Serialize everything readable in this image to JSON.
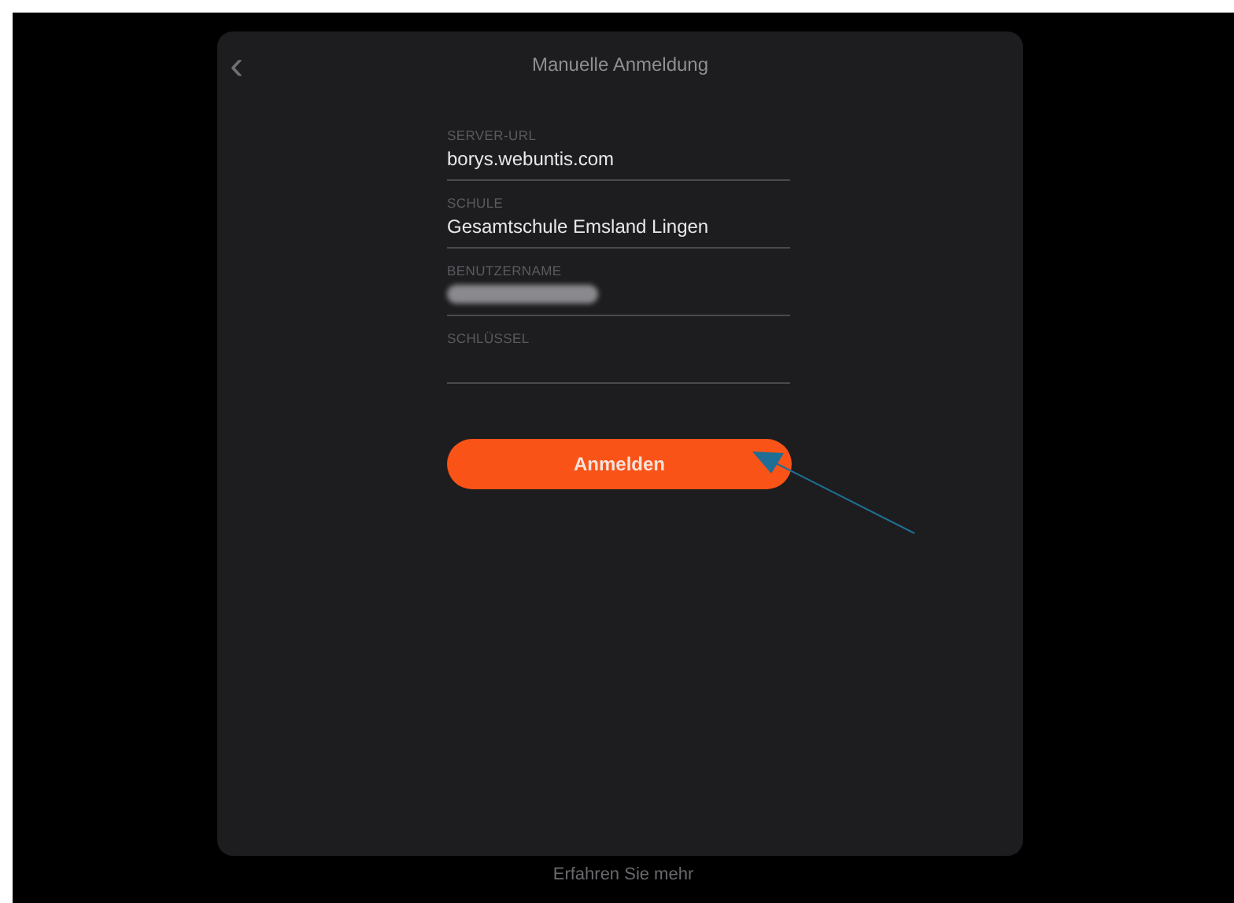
{
  "header": {
    "title": "Manuelle Anmeldung",
    "back": "‹"
  },
  "fields": [
    {
      "kind": "text",
      "label": "SERVER-URL",
      "value": "borys.webuntis.com"
    },
    {
      "kind": "text",
      "label": "SCHULE",
      "value": "Gesamtschule Emsland Lingen"
    },
    {
      "kind": "redacted",
      "label": "BENUTZERNAME"
    },
    {
      "kind": "password",
      "label": "SCHLÜSSEL"
    }
  ],
  "submit": "Anmelden",
  "footer_link": "Erfahren Sie mehr"
}
